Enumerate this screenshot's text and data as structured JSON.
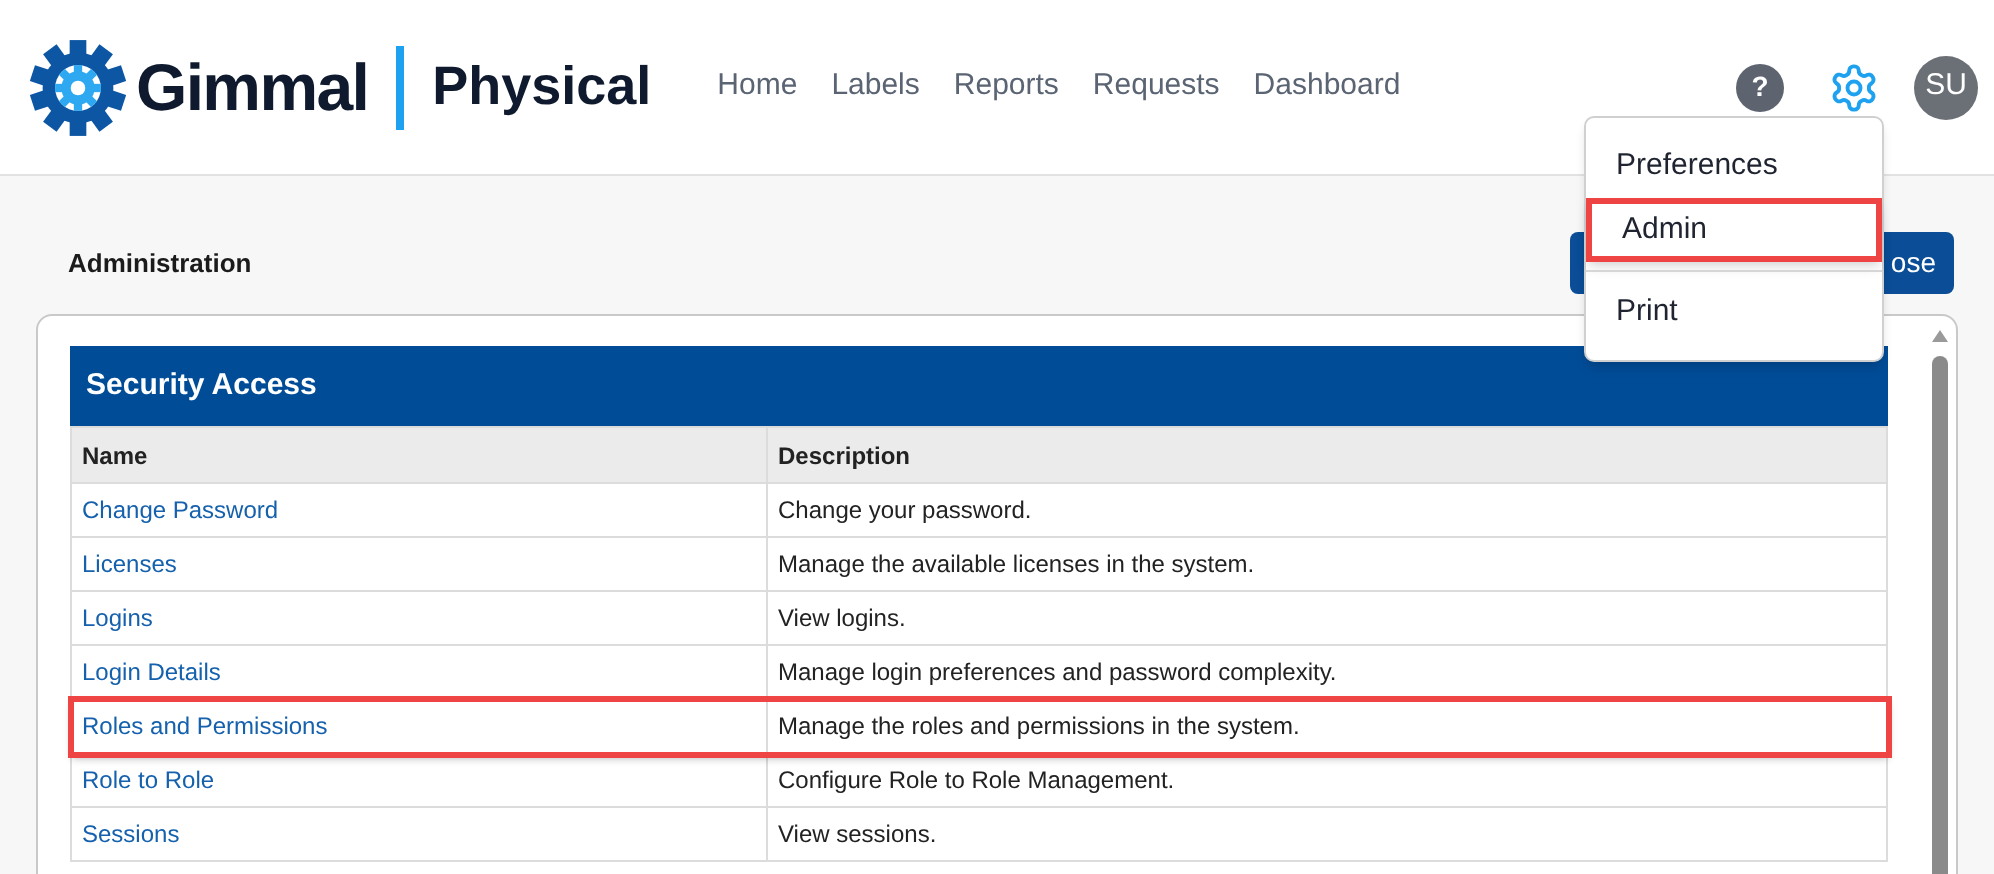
{
  "header": {
    "logo_text": "Gimmal",
    "product": "Physical",
    "nav": [
      {
        "label": "Home"
      },
      {
        "label": "Labels"
      },
      {
        "label": "Reports"
      },
      {
        "label": "Requests"
      },
      {
        "label": "Dashboard"
      }
    ],
    "help_icon": "?",
    "avatar": "SU"
  },
  "settings_menu": {
    "items": [
      {
        "label": "Preferences",
        "highlighted": false
      },
      {
        "label": "Admin",
        "highlighted": true
      },
      {
        "kind": "divider"
      },
      {
        "label": "Print",
        "highlighted": false
      }
    ]
  },
  "page": {
    "title": "Administration",
    "close_button": "ose"
  },
  "section": {
    "title": "Security Access",
    "columns": [
      "Name",
      "Description"
    ],
    "rows": [
      {
        "name": "Change Password",
        "description": "Change your password.",
        "highlighted": false
      },
      {
        "name": "Licenses",
        "description": "Manage the available licenses in the system.",
        "highlighted": false
      },
      {
        "name": "Logins",
        "description": "View logins.",
        "highlighted": false
      },
      {
        "name": "Login Details",
        "description": "Manage login preferences and password complexity.",
        "highlighted": false
      },
      {
        "name": "Roles and Permissions",
        "description": "Manage the roles and permissions in the system.",
        "highlighted": true
      },
      {
        "name": "Role to Role",
        "description": "Configure Role to Role Management.",
        "highlighted": false
      },
      {
        "name": "Sessions",
        "description": "View sessions.",
        "highlighted": false
      }
    ]
  }
}
